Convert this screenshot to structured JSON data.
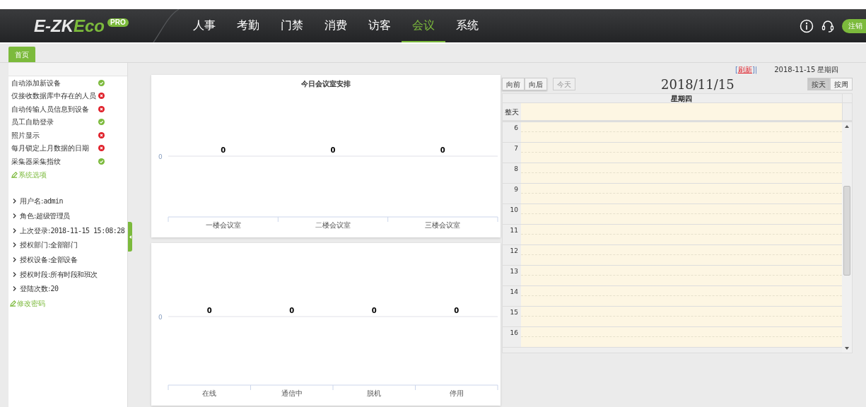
{
  "header": {
    "logo": {
      "main": "E-ZK",
      "accent": "Eco",
      "badge": "PRO"
    },
    "nav": [
      {
        "label": "人事",
        "selected": false
      },
      {
        "label": "考勤",
        "selected": false
      },
      {
        "label": "门禁",
        "selected": false
      },
      {
        "label": "消费",
        "selected": false
      },
      {
        "label": "访客",
        "selected": false
      },
      {
        "label": "会议",
        "selected": true
      },
      {
        "label": "系统",
        "selected": false
      }
    ],
    "logout": "注销"
  },
  "tabs": [
    {
      "label": "首页",
      "selected": true
    }
  ],
  "sidebar": {
    "settings": [
      {
        "label": "自动添加新设备",
        "on": true
      },
      {
        "label": "仅接收数据库中存在的人员",
        "on": false
      },
      {
        "label": "自动传输人员信息到设备",
        "on": false
      },
      {
        "label": "员工自助登录",
        "on": true
      },
      {
        "label": "照片显示",
        "on": false
      },
      {
        "label": "每月锁定上月数据的日期",
        "on": false
      },
      {
        "label": "采集器采集指纹",
        "on": true
      }
    ],
    "settings_link": "系统选项",
    "user_info": [
      {
        "label": "用户名:",
        "value": "admin"
      },
      {
        "label": "角色:",
        "value": "超级管理员"
      },
      {
        "label": "上次登录:",
        "value": "2018-11-15 15:08:28"
      },
      {
        "label": "授权部门:",
        "value": "全部部门"
      },
      {
        "label": "授权设备:",
        "value": "全部设备"
      },
      {
        "label": "授权时段:",
        "value": "所有时段和班次"
      },
      {
        "label": "登陆次数:",
        "value": "20"
      }
    ],
    "password_link": "修改密码"
  },
  "charts": [
    {
      "kind": "bar",
      "title": "今日会议室安排",
      "y_axis_label": "0",
      "groups": [
        {
          "category": "一楼会议室",
          "value_label": "0"
        },
        {
          "category": "二楼会议室",
          "value_label": "0"
        },
        {
          "category": "三楼会议室",
          "value_label": "0"
        }
      ]
    },
    {
      "kind": "bar",
      "y_axis_label": "0",
      "groups": [
        {
          "category": "在线",
          "value_label": "0"
        },
        {
          "category": "通信中",
          "value_label": "0"
        },
        {
          "category": "脱机",
          "value_label": "0"
        },
        {
          "category": "停用",
          "value_label": "0"
        }
      ]
    }
  ],
  "calendar": {
    "refresh_prefix": "[",
    "refresh": "刷新",
    "refresh_suffix": "]|",
    "today_info": "2018-11-15 星期四",
    "nav_buttons": [
      {
        "label": "向前",
        "disabled": false
      },
      {
        "label": "向后",
        "disabled": false
      },
      {
        "label": "今天",
        "disabled": true
      }
    ],
    "title": "2018/11/15",
    "views": [
      {
        "label": "按天",
        "selected": true
      },
      {
        "label": "按周",
        "selected": false
      }
    ],
    "day_header": "星期四",
    "all_day": "整天",
    "hours": [
      "6",
      "7",
      "8",
      "9",
      "10",
      "11",
      "12",
      "13",
      "14",
      "15",
      "16"
    ]
  }
}
